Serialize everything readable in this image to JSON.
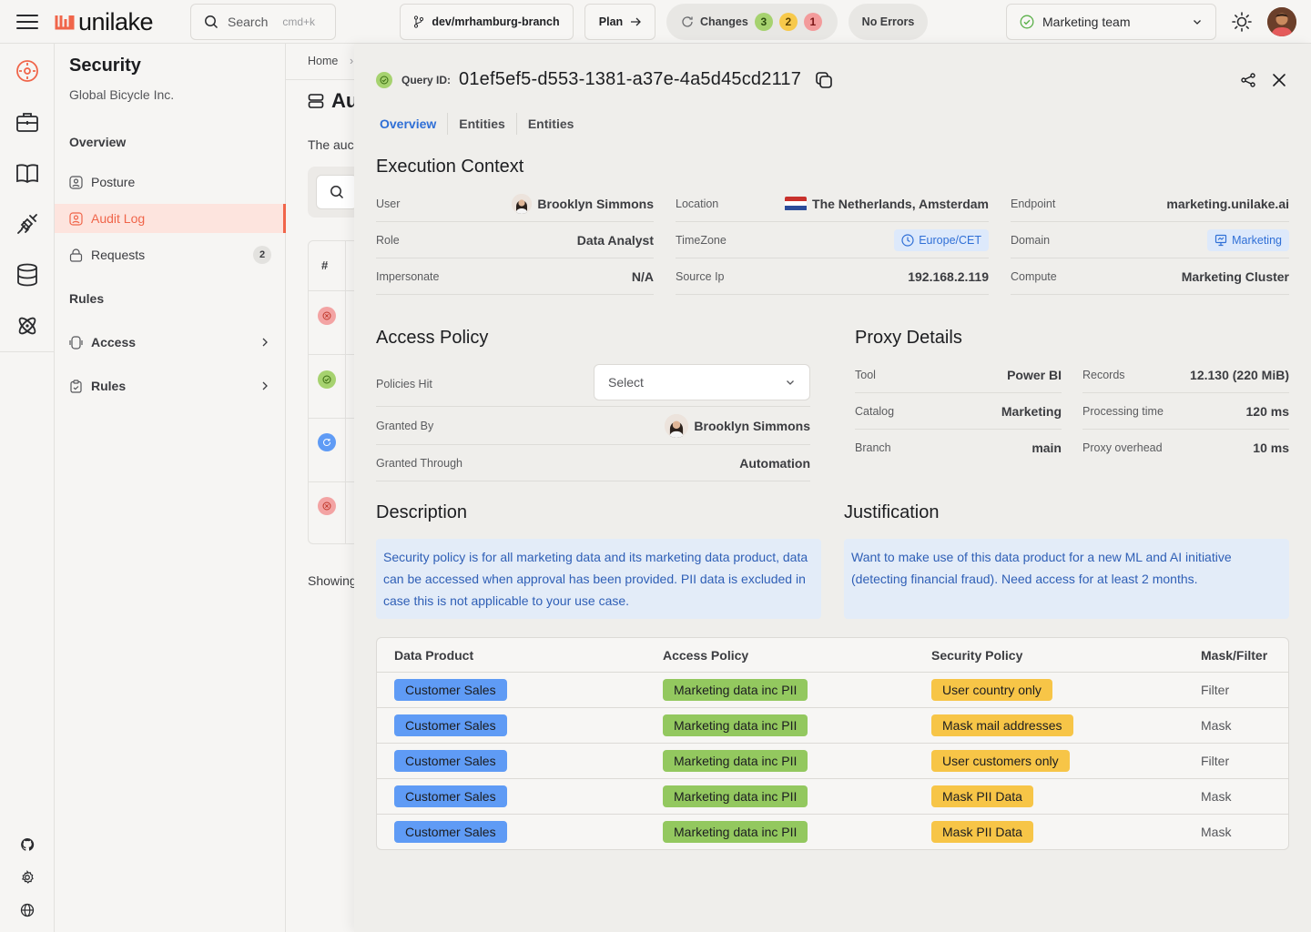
{
  "app": {
    "name": "unilake",
    "search": {
      "placeholder": "Search",
      "shortcut": "cmd+k"
    },
    "branch": "dev/mrhamburg-branch",
    "plan_label": "Plan",
    "changes": {
      "label": "Changes",
      "green": "3",
      "yellow": "2",
      "red": "1"
    },
    "errors_label": "No Errors",
    "team": "Marketing team",
    "colors": {
      "accent": "#f0654a",
      "link": "#2f6fd6"
    }
  },
  "rail": {
    "icons": [
      "compass-icon",
      "briefcase-icon",
      "book-icon",
      "plug-icon",
      "database-icon",
      "atom-icon"
    ],
    "bottom_icons": [
      "github-icon",
      "settings-icon",
      "globe-icon"
    ]
  },
  "sidebar": {
    "title": "Security",
    "subtitle": "Global Bicycle Inc.",
    "overview_heading": "Overview",
    "items": [
      {
        "label": "Posture"
      },
      {
        "label": "Audit Log"
      },
      {
        "label": "Requests",
        "badge": "2"
      }
    ],
    "rules_heading": "Rules",
    "groups": [
      {
        "label": "Access"
      },
      {
        "label": "Rules"
      }
    ]
  },
  "background": {
    "breadcrumb_home": "Home",
    "breadcrumb_sep": "›",
    "title_partial": "Au",
    "desc_partial": "The auc",
    "table_hash": "#",
    "showing_partial": "Showing"
  },
  "drawer": {
    "query_label": "Query ID:",
    "query_id": "01ef5ef5-d553-1381-a37e-4a5d45cd2117",
    "tabs": [
      "Overview",
      "Entities",
      "Entities"
    ],
    "execution_context": {
      "title": "Execution Context",
      "user_label": "User",
      "user_value": "Brooklyn Simmons",
      "role_label": "Role",
      "role_value": "Data Analyst",
      "impersonate_label": "Impersonate",
      "impersonate_value": "N/A",
      "location_label": "Location",
      "location_value": "The Netherlands, Amsterdam",
      "timezone_label": "TimeZone",
      "timezone_value": "Europe/CET",
      "source_ip_label": "Source Ip",
      "source_ip_value": "192.168.2.119",
      "endpoint_label": "Endpoint",
      "endpoint_value": "marketing.unilake.ai",
      "domain_label": "Domain",
      "domain_value": "Marketing",
      "compute_label": "Compute",
      "compute_value": "Marketing Cluster"
    },
    "access_policy": {
      "title": "Access Policy",
      "policies_hit_label": "Policies Hit",
      "select_placeholder": "Select",
      "granted_by_label": "Granted By",
      "granted_by_value": "Brooklyn Simmons",
      "granted_through_label": "Granted Through",
      "granted_through_value": "Automation"
    },
    "proxy_details": {
      "title": "Proxy Details",
      "tool_label": "Tool",
      "tool_value": "Power BI",
      "catalog_label": "Catalog",
      "catalog_value": "Marketing",
      "branch_label": "Branch",
      "branch_value": "main",
      "records_label": "Records",
      "records_value": "12.130 (220 MiB)",
      "processing_label": "Processing time",
      "processing_value": "120 ms",
      "overhead_label": "Proxy overhead",
      "overhead_value": "10 ms"
    },
    "description": {
      "title": "Description",
      "text": "Security policy is for all marketing data and its marketing data product, data can be accessed when approval has been provided. PII data is excluded in case this is not applicable to your use case."
    },
    "justification": {
      "title": "Justification",
      "text": "Want to make use of this data product for a new ML and AI initiative (detecting financial fraud). Need access for at least 2 months."
    },
    "table": {
      "columns": [
        "Data Product",
        "Access Policy",
        "Security Policy",
        "Mask/Filter"
      ],
      "rows": [
        {
          "product": "Customer Sales",
          "access": "Marketing data inc PII",
          "security": "User country only",
          "type": "Filter"
        },
        {
          "product": "Customer Sales",
          "access": "Marketing data inc PII",
          "security": "Mask mail addresses",
          "type": "Mask"
        },
        {
          "product": "Customer Sales",
          "access": "Marketing data inc PII",
          "security": "User customers only",
          "type": "Filter"
        },
        {
          "product": "Customer Sales",
          "access": "Marketing data inc PII",
          "security": "Mask PII Data",
          "type": "Mask"
        },
        {
          "product": "Customer Sales",
          "access": "Marketing data inc PII",
          "security": "Mask PII Data",
          "type": "Mask"
        }
      ]
    }
  }
}
